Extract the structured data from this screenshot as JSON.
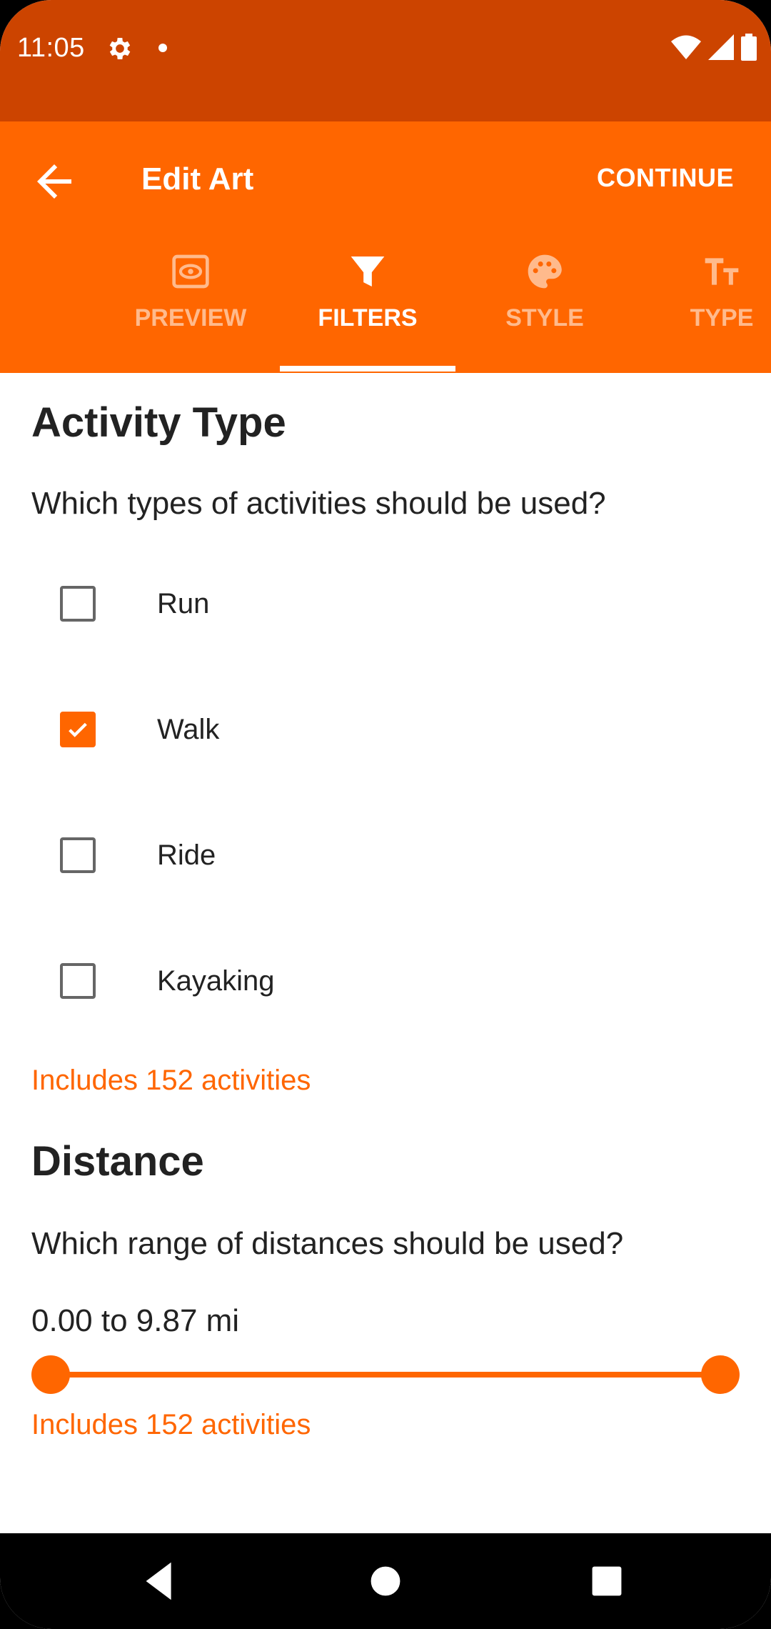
{
  "status_bar": {
    "time": "11:05"
  },
  "app_bar": {
    "title": "Edit Art",
    "continue_label": "CONTINUE",
    "tabs": [
      {
        "label": "PREVIEW",
        "icon": "eye-icon",
        "active": false
      },
      {
        "label": "FILTERS",
        "icon": "filter-icon",
        "active": true
      },
      {
        "label": "STYLE",
        "icon": "palette-icon",
        "active": false
      },
      {
        "label": "TYPE",
        "icon": "text-size-icon",
        "active": false
      }
    ]
  },
  "activity_type": {
    "heading": "Activity Type",
    "question": "Which types of activities should be used?",
    "options": [
      {
        "label": "Run",
        "checked": false
      },
      {
        "label": "Walk",
        "checked": true
      },
      {
        "label": "Ride",
        "checked": false
      },
      {
        "label": "Kayaking",
        "checked": false
      }
    ],
    "count_text": "Includes 152 activities"
  },
  "distance": {
    "heading": "Distance",
    "question": "Which range of distances should be used?",
    "range_text": "0.00 to 9.87 mi",
    "range_min": 0.0,
    "range_max": 9.87,
    "count_text": "Includes 152 activities"
  },
  "colors": {
    "accent": "#FF6600",
    "status_bar": "#CC4400"
  }
}
